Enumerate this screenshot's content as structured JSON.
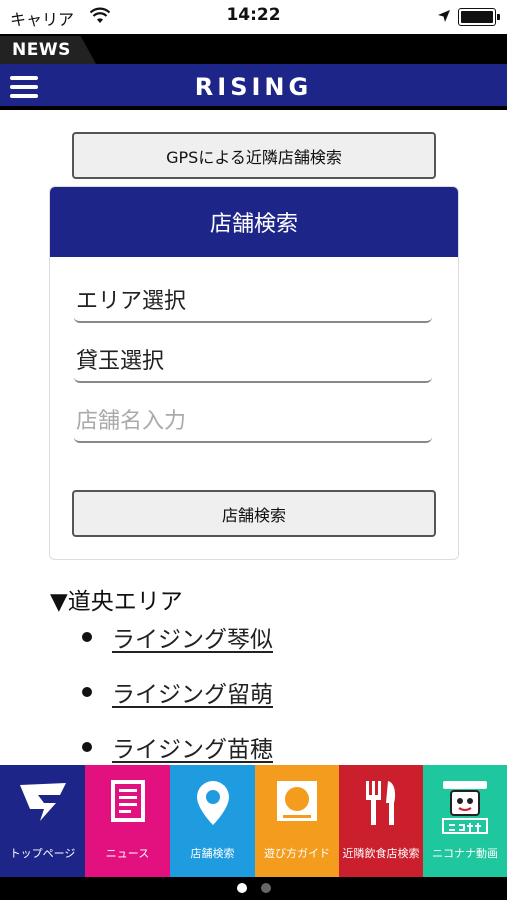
{
  "status": {
    "carrier": "キャリア",
    "time": "14:22"
  },
  "news": {
    "label": "NEWS"
  },
  "header": {
    "logo": "RISING"
  },
  "gps_button": "GPSによる近隣店舗検索",
  "search": {
    "title": "店舗検索",
    "area_select": "エリア選択",
    "ball_select": "貸玉選択",
    "name_placeholder": "店舗名入力",
    "button": "店舗検索"
  },
  "area": {
    "title": "▼道央エリア",
    "stores": [
      "ライジング琴似",
      "ライジング留萌",
      "ライジング苗穂"
    ]
  },
  "tabs": [
    {
      "label": "トップページ",
      "icon": "logo-icon",
      "color": "#1d2589"
    },
    {
      "label": "ニュース",
      "icon": "news-icon",
      "color": "#e3107f"
    },
    {
      "label": "店舗検索",
      "icon": "location-pin-icon",
      "color": "#1f9be0"
    },
    {
      "label": "遊び方ガイド",
      "icon": "guide-icon",
      "color": "#f39c1e"
    },
    {
      "label": "近隣飲食店検索",
      "icon": "fork-knife-icon",
      "color": "#cc1f2d"
    },
    {
      "label": "ニコナナ動画",
      "icon": "nikonana-icon",
      "color": "#1fc79e"
    }
  ],
  "pager": {
    "pages": 2,
    "current": 1
  }
}
